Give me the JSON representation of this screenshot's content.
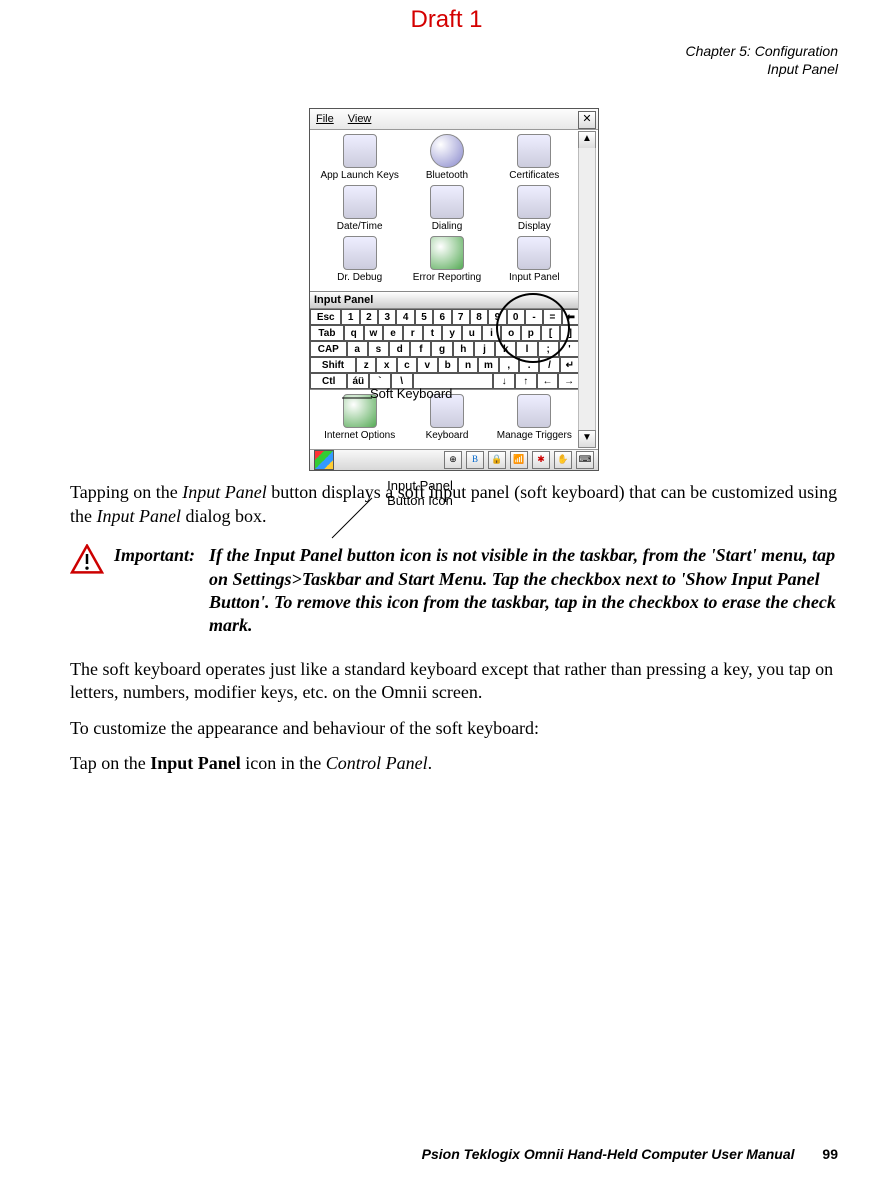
{
  "draft": "Draft 1",
  "header": {
    "chapter": "Chapter 5: Configuration",
    "section": "Input Panel"
  },
  "figure": {
    "menubar": {
      "file": "File",
      "view": "View"
    },
    "icons": {
      "r1": [
        "App Launch Keys",
        "Bluetooth",
        "Certificates"
      ],
      "r2": [
        "Date/Time",
        "Dialing",
        "Display"
      ],
      "r3": [
        "Dr. Debug",
        "Error Reporting",
        "Input Panel"
      ],
      "r4": [
        "Internet Options",
        "Keyboard",
        "Manage Triggers"
      ]
    },
    "ip_title": "Input Panel",
    "kbd": {
      "r1": [
        "Esc",
        "1",
        "2",
        "3",
        "4",
        "5",
        "6",
        "7",
        "8",
        "9",
        "0",
        "-",
        "=",
        "⬅"
      ],
      "r2": [
        "Tab",
        "q",
        "w",
        "e",
        "r",
        "t",
        "y",
        "u",
        "i",
        "o",
        "p",
        "[",
        "]"
      ],
      "r3": [
        "CAP",
        "a",
        "s",
        "d",
        "f",
        "g",
        "h",
        "j",
        "k",
        "l",
        ";",
        "'"
      ],
      "r4": [
        "Shift",
        "z",
        "x",
        "c",
        "v",
        "b",
        "n",
        "m",
        ",",
        ".",
        "/",
        "↵"
      ],
      "r5": [
        "Ctl",
        "áü",
        "`",
        "\\",
        "↓",
        "↑",
        "←",
        "→"
      ]
    },
    "callouts": {
      "soft_keyboard": "Soft Keyboard",
      "input_panel_icon": "Input Panel Button Icon"
    }
  },
  "body": {
    "p1a": "Tapping on the ",
    "p1b": "Input Panel",
    "p1c": " button displays a soft input panel (soft keyboard) that can be customized using the ",
    "p1d": "Input Panel",
    "p1e": " dialog box.",
    "important_label": "Important:",
    "important_text": "If the Input Panel button icon is not visible in the taskbar, from the 'Start' menu, tap on Settings>Taskbar and Start Menu. Tap the checkbox next to 'Show Input Panel Button'. To remove this icon from the taskbar, tap in the checkbox to erase the check mark.",
    "p2": "The soft keyboard operates just like a standard keyboard except that rather than pressing a key, you tap on letters, numbers, modifier keys, etc. on the Omnii screen.",
    "p3": "To customize the appearance and behaviour of the soft keyboard:",
    "p4a": "Tap on the ",
    "p4b": "Input Panel",
    "p4c": " icon in the ",
    "p4d": "Control Panel",
    "p4e": "."
  },
  "footer": {
    "text": "Psion Teklogix Omnii Hand-Held Computer User Manual",
    "page": "99"
  }
}
